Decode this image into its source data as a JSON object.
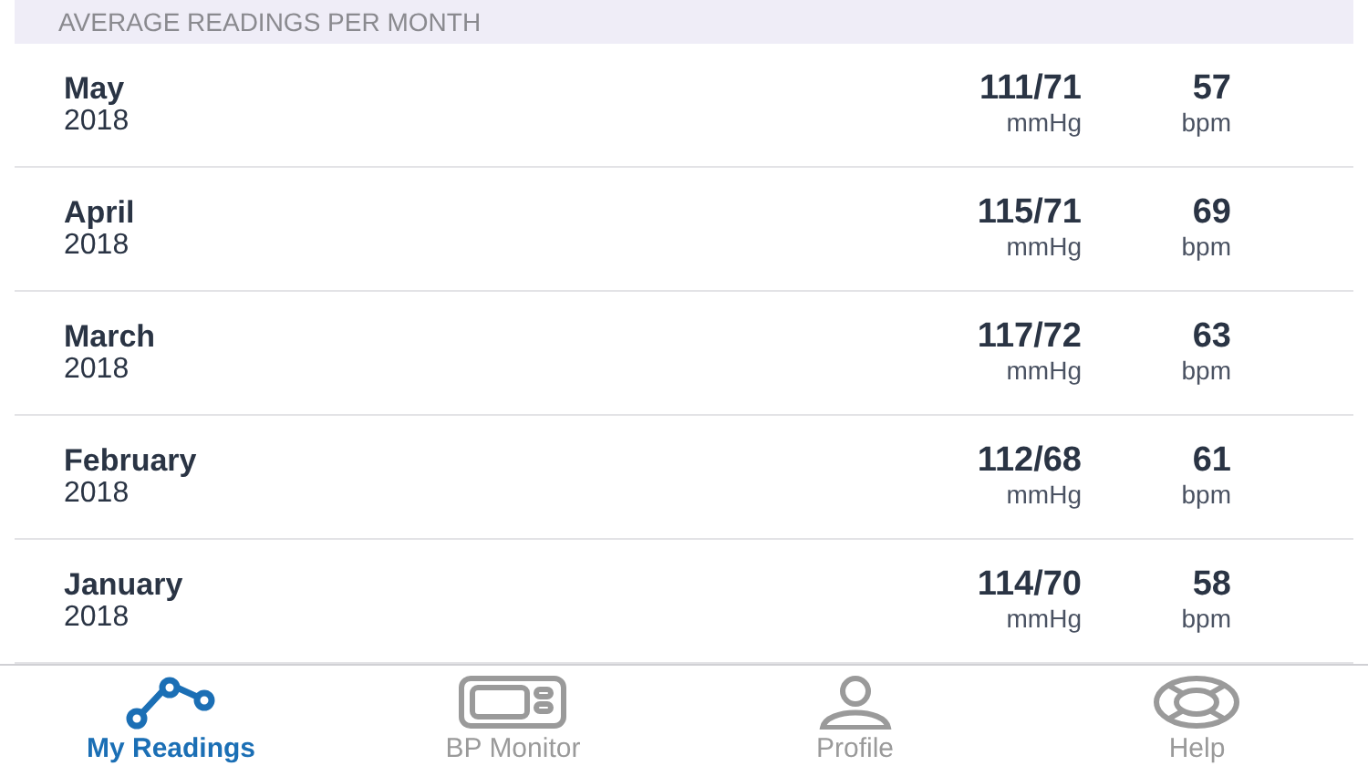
{
  "section_header": "AVERAGE READINGS PER MONTH",
  "readings": [
    {
      "month": "May",
      "year": "2018",
      "pressure": "111/71",
      "pressure_unit": "mmHg",
      "pulse": "57",
      "pulse_unit": "bpm"
    },
    {
      "month": "April",
      "year": "2018",
      "pressure": "115/71",
      "pressure_unit": "mmHg",
      "pulse": "69",
      "pulse_unit": "bpm"
    },
    {
      "month": "March",
      "year": "2018",
      "pressure": "117/72",
      "pressure_unit": "mmHg",
      "pulse": "63",
      "pulse_unit": "bpm"
    },
    {
      "month": "February",
      "year": "2018",
      "pressure": "112/68",
      "pressure_unit": "mmHg",
      "pulse": "61",
      "pulse_unit": "bpm"
    },
    {
      "month": "January",
      "year": "2018",
      "pressure": "114/70",
      "pressure_unit": "mmHg",
      "pulse": "58",
      "pulse_unit": "bpm"
    }
  ],
  "tabs": [
    {
      "label": "My Readings",
      "kind": "chart",
      "selected": true
    },
    {
      "label": "BP Monitor",
      "kind": "monitor",
      "selected": false
    },
    {
      "label": "Profile",
      "kind": "person",
      "selected": false
    },
    {
      "label": "Help",
      "kind": "lifebuoy",
      "selected": false
    }
  ]
}
